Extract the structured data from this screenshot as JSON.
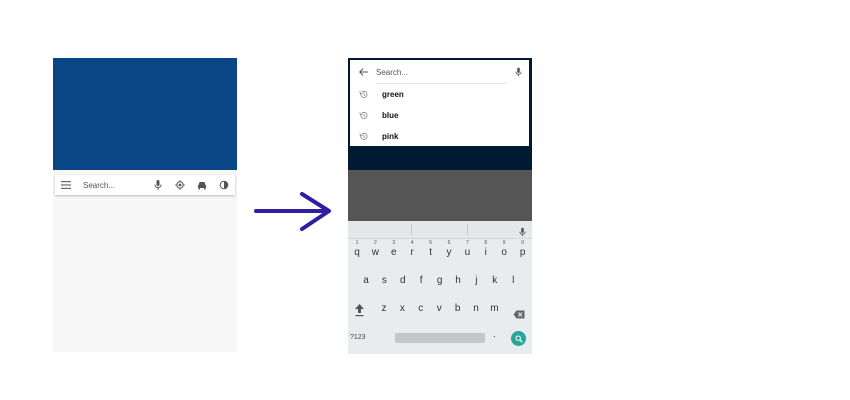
{
  "left_screen": {
    "search_placeholder": "Search...",
    "hero_color": "#0a4586",
    "icons": [
      "menu-icon",
      "mic-icon",
      "my-location-icon",
      "car-icon",
      "contrast-icon"
    ]
  },
  "right_screen": {
    "search_placeholder": "Search...",
    "history": [
      {
        "label": "green"
      },
      {
        "label": "blue"
      },
      {
        "label": "pink"
      }
    ],
    "keyboard": {
      "row1": [
        "q",
        "w",
        "e",
        "r",
        "t",
        "y",
        "u",
        "i",
        "o",
        "p"
      ],
      "row1_hints": [
        "1",
        "2",
        "3",
        "4",
        "5",
        "6",
        "7",
        "8",
        "9",
        "0"
      ],
      "row2": [
        "a",
        "s",
        "d",
        "f",
        "g",
        "h",
        "j",
        "k",
        "l"
      ],
      "row3": [
        "z",
        "x",
        "c",
        "v",
        "b",
        "n",
        "m"
      ],
      "symbols_key": "?123",
      "period_key": ".",
      "accent_color": "#27a69a"
    }
  },
  "arrow_color": "#2e1fa0"
}
